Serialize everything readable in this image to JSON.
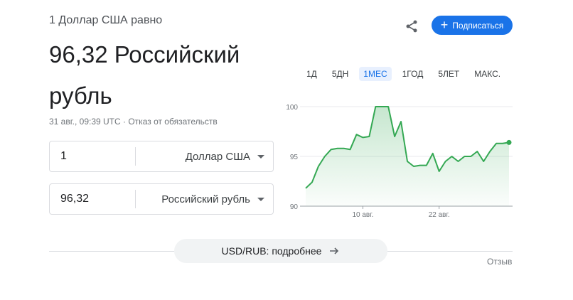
{
  "header": {
    "subtitle": "1 Доллар США равно",
    "amount": "96,32 Российский",
    "amount_line2": "рубль",
    "timestamp": "31 авг., 09:39 UTC",
    "dot": " · ",
    "disclaimer": "Отказ от обязательств"
  },
  "actions": {
    "share_icon": "share-icon",
    "subscribe_label": "Подписаться"
  },
  "converter": {
    "from_value": "1",
    "from_currency": "Доллар США",
    "to_value": "96,32",
    "to_currency": "Российский рубль"
  },
  "range_tabs": [
    "1Д",
    "5ДН",
    "1МЕС",
    "1ГОД",
    "5ЛЕТ",
    "МАКС."
  ],
  "active_tab": "1МЕС",
  "more_link": "USD/RUB: подробнее",
  "feedback": "Отзыв",
  "colors": {
    "accent": "#1a73e8",
    "line": "#34a853"
  },
  "chart_data": {
    "type": "area",
    "title": "",
    "xlabel": "",
    "ylabel": "",
    "ylim": [
      90,
      100
    ],
    "y_ticks": [
      100,
      95,
      90
    ],
    "x_tick_labels": [
      "10 авг.",
      "22 авг."
    ],
    "x_tick_index": [
      9,
      21
    ],
    "series": [
      {
        "values": [
          91.8,
          92.4,
          94.0,
          95.0,
          95.7,
          95.8,
          95.8,
          95.7,
          97.2,
          96.9,
          97.0,
          100.0,
          100.0,
          100.0,
          97.0,
          98.5,
          94.5,
          94.0,
          94.1,
          94.1,
          95.3,
          93.5,
          94.5,
          95.0,
          94.5,
          95.0,
          95.0,
          95.5,
          94.5,
          95.5,
          96.3,
          96.3,
          96.4
        ]
      }
    ]
  }
}
